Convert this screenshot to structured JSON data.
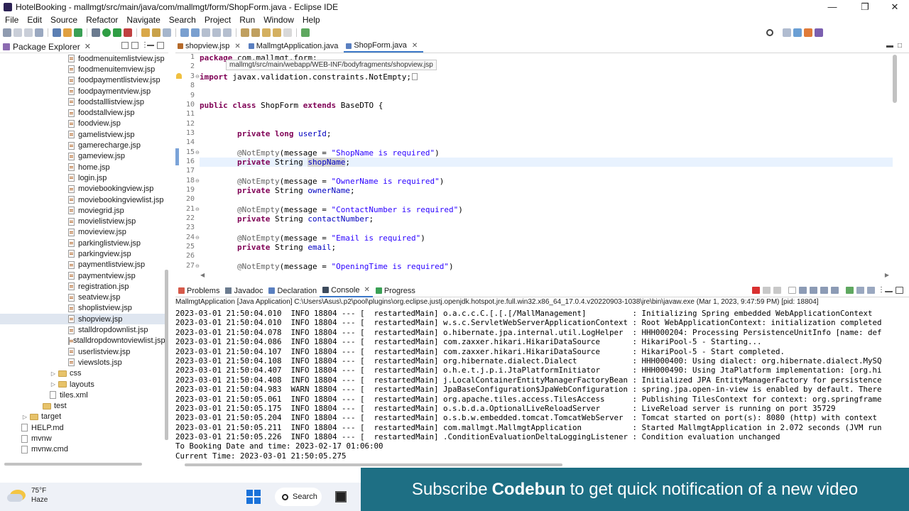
{
  "window": {
    "title": "HotelBooking - mallmgt/src/main/java/com/mallmgt/form/ShopForm.java - Eclipse IDE"
  },
  "menu": [
    "File",
    "Edit",
    "Source",
    "Refactor",
    "Navigate",
    "Search",
    "Project",
    "Run",
    "Window",
    "Help"
  ],
  "package_explorer": {
    "tab_label": "Package Explorer",
    "items": [
      {
        "label": "foodmenuitemlistview.jsp",
        "type": "jsp",
        "indent": 3
      },
      {
        "label": "foodmenuitemview.jsp",
        "type": "jsp",
        "indent": 3
      },
      {
        "label": "foodpaymentlistview.jsp",
        "type": "jsp",
        "indent": 3
      },
      {
        "label": "foodpaymentview.jsp",
        "type": "jsp",
        "indent": 3
      },
      {
        "label": "foodstalllistview.jsp",
        "type": "jsp",
        "indent": 3
      },
      {
        "label": "foodstallview.jsp",
        "type": "jsp",
        "indent": 3
      },
      {
        "label": "foodview.jsp",
        "type": "jsp",
        "indent": 3
      },
      {
        "label": "gamelistview.jsp",
        "type": "jsp",
        "indent": 3
      },
      {
        "label": "gamerecharge.jsp",
        "type": "jsp",
        "indent": 3
      },
      {
        "label": "gameview.jsp",
        "type": "jsp",
        "indent": 3
      },
      {
        "label": "home.jsp",
        "type": "jsp",
        "indent": 3
      },
      {
        "label": "login.jsp",
        "type": "jsp",
        "indent": 3
      },
      {
        "label": "moviebookingview.jsp",
        "type": "jsp",
        "indent": 3
      },
      {
        "label": "moviebookingviewlist.jsp",
        "type": "jsp",
        "indent": 3
      },
      {
        "label": "moviegrid.jsp",
        "type": "jsp",
        "indent": 3
      },
      {
        "label": "movielistview.jsp",
        "type": "jsp",
        "indent": 3
      },
      {
        "label": "movieview.jsp",
        "type": "jsp",
        "indent": 3
      },
      {
        "label": "parkinglistview.jsp",
        "type": "jsp",
        "indent": 3
      },
      {
        "label": "parkingview.jsp",
        "type": "jsp",
        "indent": 3
      },
      {
        "label": "paymentlistview.jsp",
        "type": "jsp",
        "indent": 3
      },
      {
        "label": "paymentview.jsp",
        "type": "jsp",
        "indent": 3
      },
      {
        "label": "registration.jsp",
        "type": "jsp",
        "indent": 3
      },
      {
        "label": "seatview.jsp",
        "type": "jsp",
        "indent": 3
      },
      {
        "label": "shoplistview.jsp",
        "type": "jsp",
        "indent": 3
      },
      {
        "label": "shopview.jsp",
        "type": "jsp",
        "indent": 3,
        "selected": true
      },
      {
        "label": "stalldropdownlist.jsp",
        "type": "jsp",
        "indent": 3
      },
      {
        "label": "stalldropdowntoviewlist.jsp",
        "type": "jsp",
        "indent": 3
      },
      {
        "label": "userlistview.jsp",
        "type": "jsp",
        "indent": 3
      },
      {
        "label": "viewslots.jsp",
        "type": "jsp",
        "indent": 3
      },
      {
        "label": "css",
        "type": "folder",
        "indent": 2
      },
      {
        "label": "layouts",
        "type": "folder",
        "indent": 2
      },
      {
        "label": "tiles.xml",
        "type": "file",
        "indent": 2
      },
      {
        "label": "test",
        "type": "folder",
        "indent": 1
      },
      {
        "label": "target",
        "type": "folder",
        "indent": 0
      },
      {
        "label": "HELP.md",
        "type": "file",
        "indent": 0
      },
      {
        "label": "mvnw",
        "type": "file",
        "indent": 0
      },
      {
        "label": "mvnw.cmd",
        "type": "file",
        "indent": 0
      }
    ]
  },
  "editor": {
    "tabs": [
      {
        "label": "shopview.jsp",
        "active": false
      },
      {
        "label": "MallmgtApplication.java",
        "active": false
      },
      {
        "label": "ShopForm.java",
        "active": true
      }
    ],
    "tooltip": "mallmgt/src/main/webapp/WEB-INF/bodyfragments/shopview.jsp",
    "line_numbers": [
      "1",
      "2",
      "3",
      "8",
      "9",
      "10",
      "11",
      "12",
      "13",
      "14",
      "15",
      "16",
      "17",
      "18",
      "19",
      "20",
      "21",
      "22",
      "23",
      "24",
      "25",
      "26",
      "27"
    ],
    "code_lines": {
      "l1_kw": "package",
      "l1_rest": " com.mallmgt.form;",
      "l3_kw": "import",
      "l3_rest": " javax.validation.constraints.NotEmpty;",
      "l10_kw1": "public",
      "l10_kw2": "class",
      "l10_name": " ShopForm ",
      "l10_kw3": "extends",
      "l10_rest": " BaseDTO {",
      "private": "private",
      "long": "long",
      "userId": "userId",
      "String": "String",
      "shopName": "shopName",
      "ownerName": "ownerName",
      "contactNumber": "contactNumber",
      "email": "email",
      "ann": "@NotEmpty",
      "msg_open": "(message = ",
      "shopname_req": "\"ShopName is required\"",
      "ownername_req": "\"OwnerName is required\"",
      "contact_req": "\"ContactNumber is required\"",
      "email_req": "\"Email is required\"",
      "opening_req": "\"OpeningTime is required\"",
      "close_paren": ")",
      "semi": ";"
    }
  },
  "console": {
    "tabs": [
      "Problems",
      "Javadoc",
      "Declaration",
      "Console",
      "Progress"
    ],
    "active_tab": "Console",
    "description": "MallmgtApplication [Java Application] C:\\Users\\Asus\\.p2\\pool\\plugins\\org.eclipse.justj.openjdk.hotspot.jre.full.win32.x86_64_17.0.4.v20220903-1038\\jre\\bin\\javaw.exe  (Mar 1, 2023, 9:47:59 PM) [pid: 18804]",
    "lines": [
      "2023-03-01 21:50:04.010  INFO 18804 --- [  restartedMain] o.a.c.c.C.[.[.[/MallManagement]          : Initializing Spring embedded WebApplicationContext",
      "2023-03-01 21:50:04.010  INFO 18804 --- [  restartedMain] w.s.c.ServletWebServerApplicationContext : Root WebApplicationContext: initialization completed",
      "2023-03-01 21:50:04.078  INFO 18804 --- [  restartedMain] o.hibernate.jpa.internal.util.LogHelper  : HHH000204: Processing PersistenceUnitInfo [name: def",
      "2023-03-01 21:50:04.086  INFO 18804 --- [  restartedMain] com.zaxxer.hikari.HikariDataSource       : HikariPool-5 - Starting...",
      "2023-03-01 21:50:04.107  INFO 18804 --- [  restartedMain] com.zaxxer.hikari.HikariDataSource       : HikariPool-5 - Start completed.",
      "2023-03-01 21:50:04.108  INFO 18804 --- [  restartedMain] org.hibernate.dialect.Dialect            : HHH000400: Using dialect: org.hibernate.dialect.MySQ",
      "2023-03-01 21:50:04.407  INFO 18804 --- [  restartedMain] o.h.e.t.j.p.i.JtaPlatformInitiator       : HHH000490: Using JtaPlatform implementation: [org.hi",
      "2023-03-01 21:50:04.408  INFO 18804 --- [  restartedMain] j.LocalContainerEntityManagerFactoryBean : Initialized JPA EntityManagerFactory for persistence",
      "2023-03-01 21:50:04.983  WARN 18804 --- [  restartedMain] JpaBaseConfiguration$JpaWebConfiguration : spring.jpa.open-in-view is enabled by default. There",
      "2023-03-01 21:50:05.061  INFO 18804 --- [  restartedMain] org.apache.tiles.access.TilesAccess      : Publishing TilesContext for context: org.springframe",
      "2023-03-01 21:50:05.175  INFO 18804 --- [  restartedMain] o.s.b.d.a.OptionalLiveReloadServer       : LiveReload server is running on port 35729",
      "2023-03-01 21:50:05.204  INFO 18804 --- [  restartedMain] o.s.b.w.embedded.tomcat.TomcatWebServer  : Tomcat started on port(s): 8080 (http) with context",
      "2023-03-01 21:50:05.211  INFO 18804 --- [  restartedMain] com.mallmgt.MallmgtApplication           : Started MallmgtApplication in 2.072 seconds (JVM run",
      "2023-03-01 21:50:05.226  INFO 18804 --- [  restartedMain] .ConditionEvaluationDeltaLoggingListener : Condition evaluation unchanged",
      "To Booking Date and time: 2023-02-17 01:06:00",
      "Current Time: 2023-03-01 21:50:05.275"
    ]
  },
  "taskbar": {
    "temperature": "75°F",
    "condition": "Haze",
    "search_label": "Search"
  },
  "banner": {
    "pre": "Subscribe",
    "brand": "Codebun",
    "post": "to get quick notification of a new video"
  }
}
